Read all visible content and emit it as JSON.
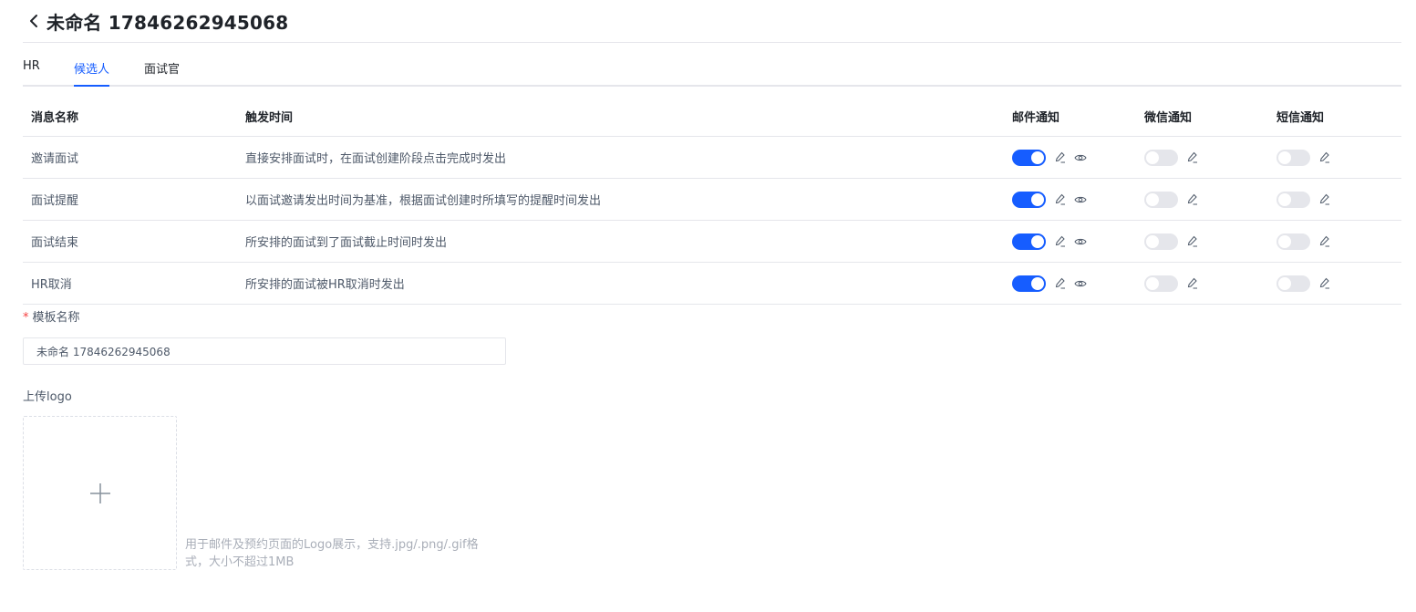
{
  "header": {
    "title": "未命名 17846262945068"
  },
  "tabs": [
    {
      "label": "HR",
      "active": false
    },
    {
      "label": "候选人",
      "active": true
    },
    {
      "label": "面试官",
      "active": false
    }
  ],
  "table": {
    "columns": {
      "name": "消息名称",
      "trigger": "触发时间",
      "mail": "邮件通知",
      "wechat": "微信通知",
      "sms": "短信通知"
    },
    "rows": [
      {
        "name": "邀请面试",
        "trigger": "直接安排面试时，在面试创建阶段点击完成时发出",
        "mail": true,
        "wechat": false,
        "sms": false
      },
      {
        "name": "面试提醒",
        "trigger": "以面试邀请发出时间为基准，根据面试创建时所填写的提醒时间发出",
        "mail": true,
        "wechat": false,
        "sms": false
      },
      {
        "name": "面试结束",
        "trigger": "所安排的面试到了面试截止时间时发出",
        "mail": true,
        "wechat": false,
        "sms": false
      },
      {
        "name": "HR取消",
        "trigger": "所安排的面试被HR取消时发出",
        "mail": true,
        "wechat": false,
        "sms": false
      }
    ]
  },
  "form": {
    "template_name_required": "*",
    "template_name_label": "模板名称",
    "template_name_value": "未命名 17846262945068",
    "logo_label": "上传logo",
    "logo_hint": "用于邮件及预约页面的Logo展示，支持.jpg/.png/.gif格式，大小不超过1MB"
  },
  "icons": {
    "back": "chevron-left-icon",
    "edit": "pen-icon",
    "preview": "eye-icon",
    "upload": "plus-icon"
  },
  "colors": {
    "accent": "#165dff",
    "switch_off": "#e5e6eb",
    "required": "#f53f3f",
    "border": "#e5e6eb"
  }
}
